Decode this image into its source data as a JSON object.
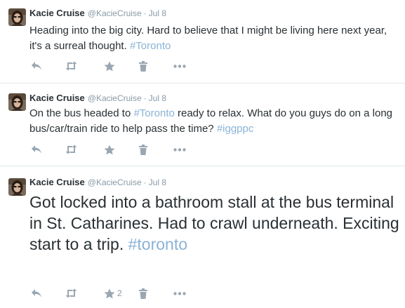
{
  "tweets": [
    {
      "fullname": "Kacie Cruise",
      "username": "@KacieCruise",
      "separator": "·",
      "time": "Jul 8",
      "text": "Heading into the big city. Hard to believe that I might be living here next year, it's a surreal thought. ",
      "hashtag": "#Toronto",
      "favorite_count": ""
    },
    {
      "fullname": "Kacie Cruise",
      "username": "@KacieCruise",
      "separator": "·",
      "time": "Jul 8",
      "text_before": "On the bus headed to ",
      "hashtag_inline": "#Toronto",
      "text_after": " ready to relax. What do you guys do on a long bus/car/train ride to help pass the time? ",
      "hashtag": "#iggppc",
      "favorite_count": ""
    },
    {
      "fullname": "Kacie Cruise",
      "username": "@KacieCruise",
      "separator": "·",
      "time": "Jul 8",
      "text": "Got locked into a bathroom stall at the bus terminal in St. Catharines. Had to crawl underneath. Exciting start to a trip. ",
      "hashtag": "#toronto",
      "favorite_count": "2"
    }
  ],
  "actions": {
    "reply_icon": "reply-icon",
    "retweet_icon": "retweet-icon",
    "favorite_icon": "star-icon",
    "delete_icon": "trash-icon",
    "more_icon": "more-dots-icon"
  },
  "colors": {
    "text": "#292f33",
    "meta": "#8899a6",
    "hashtag": "#8ab3d6",
    "icon": "#9aa7b2",
    "divider": "#e1e8ed"
  }
}
